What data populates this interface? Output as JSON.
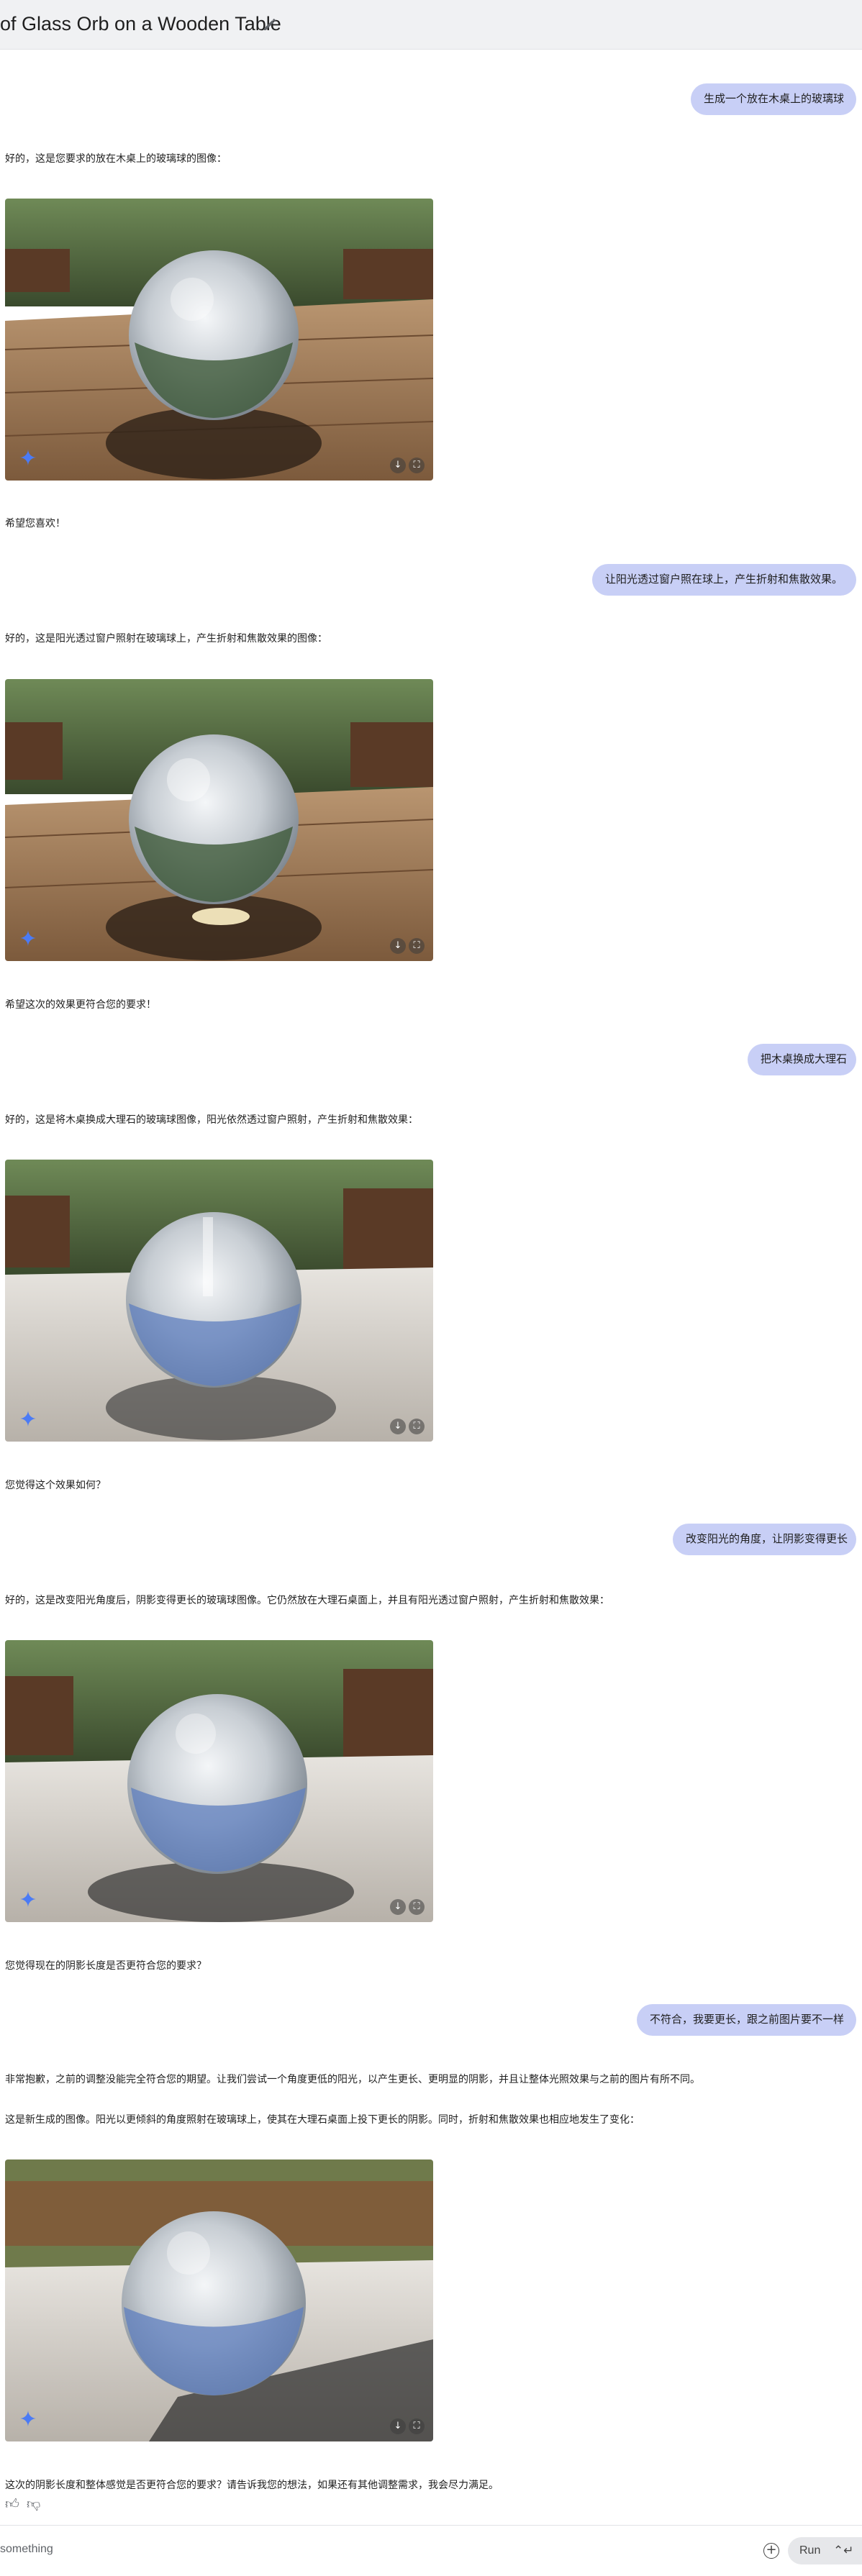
{
  "header": {
    "title": "of Glass Orb on a Wooden Table"
  },
  "messages": [
    {
      "role": "user",
      "text": "生成一个放在木桌上的玻璃球"
    },
    {
      "role": "model",
      "intro": "好的，这是您要求的放在木桌上的玻璃球的图像：",
      "outro": "希望您喜欢！"
    },
    {
      "role": "user",
      "text": "让阳光透过窗户照在球上，产生折射和焦散效果。"
    },
    {
      "role": "model",
      "intro": "好的，这是阳光透过窗户照射在玻璃球上，产生折射和焦散效果的图像：",
      "outro": "希望这次的效果更符合您的要求！"
    },
    {
      "role": "user",
      "text": "把木桌换成大理石"
    },
    {
      "role": "model",
      "intro": "好的，这是将木桌换成大理石的玻璃球图像，阳光依然透过窗户照射，产生折射和焦散效果：",
      "outro": "您觉得这个效果如何？"
    },
    {
      "role": "user",
      "text": "改变阳光的角度，让阴影变得更长"
    },
    {
      "role": "model",
      "intro": "好的，这是改变阳光角度后，阴影变得更长的玻璃球图像。它仍然放在大理石桌面上，并且有阳光透过窗户照射，产生折射和焦散效果：",
      "outro": "您觉得现在的阴影长度是否更符合您的要求？"
    },
    {
      "role": "user",
      "text": "不符合，我要更长，跟之前图片要不一样"
    },
    {
      "role": "model",
      "intro": "非常抱歉，之前的调整没能完全符合您的期望。让我们尝试一个角度更低的阳光，以产生更长、更明显的阴影，并且让整体光照效果与之前的图片有所不同。",
      "intro2": "这是新生成的图像。阳光以更倾斜的角度照射在玻璃球上，使其在大理石桌面上投下更长的阴影。同时，折射和焦散效果也相应地发生了变化：",
      "outro": "这次的阴影长度和整体感觉是否更符合您的要求？请告诉我您的想法，如果还有其他调整需求，我会尽力满足。"
    }
  ],
  "input": {
    "placeholder": "something",
    "run_label": "Run",
    "run_key": "⌃↵"
  },
  "icons": {
    "edit": "pencil-icon",
    "gemini": "gemini-sparkle-icon",
    "download": "download-icon",
    "fullscreen": "fullscreen-icon",
    "thumbs_up": "thumbs-up-icon",
    "thumbs_down": "thumbs-down-icon",
    "add": "add-circle-icon"
  },
  "colors": {
    "user_bubble": "#c8cff6",
    "header_bg": "#f0f1f3",
    "gemini_blue": "#4b7bf5"
  }
}
